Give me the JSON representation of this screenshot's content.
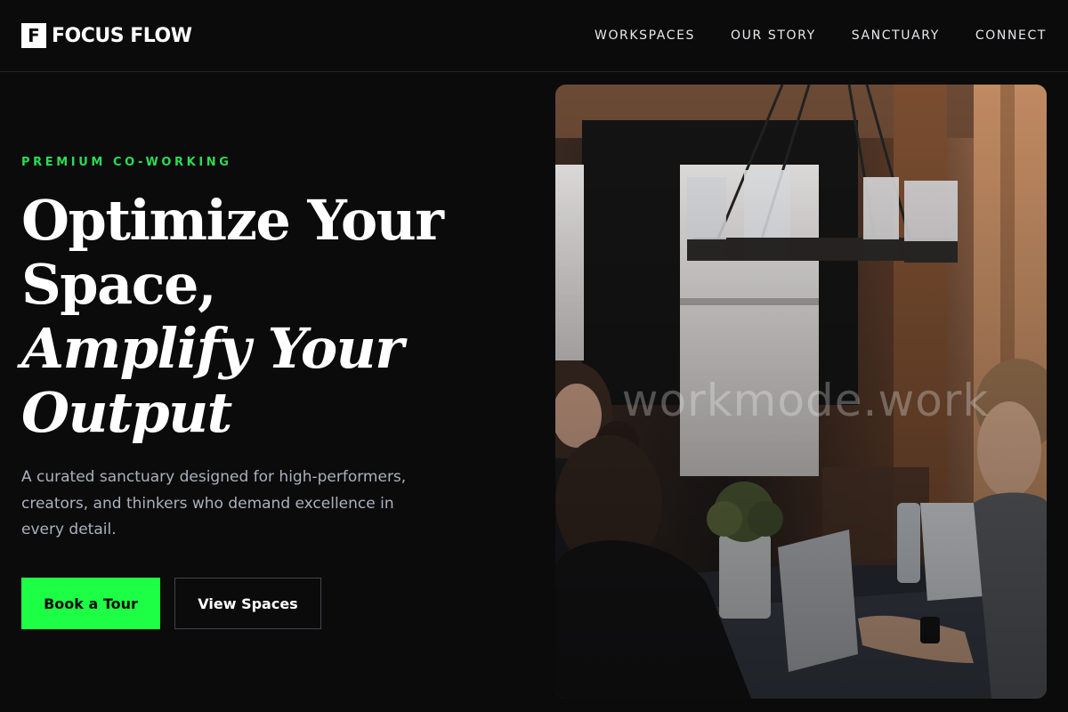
{
  "brand": {
    "logo_letter": "F",
    "name": "FOCUS FLOW"
  },
  "nav": {
    "items": [
      {
        "label": "WORKSPACES"
      },
      {
        "label": "OUR STORY"
      },
      {
        "label": "SANCTUARY"
      },
      {
        "label": "CONNECT"
      }
    ]
  },
  "hero": {
    "eyebrow": "PREMIUM CO-WORKING",
    "headline": {
      "line1": "Optimize Your",
      "line2": "Space,",
      "line3": "Amplify Your",
      "line4": "Output"
    },
    "subtext": "A curated sanctuary designed for high-performers, creators, and thinkers who demand excellence in every detail.",
    "primary_button": "Book a Tour",
    "secondary_button": "View Spaces"
  },
  "image": {
    "watermark": "workmode.work",
    "description_icon": "coworking-photo"
  },
  "colors": {
    "background": "#0b0b0c",
    "accent": "#1dff45",
    "eyebrow": "#2bdc53",
    "subtext": "#aab1bd"
  }
}
